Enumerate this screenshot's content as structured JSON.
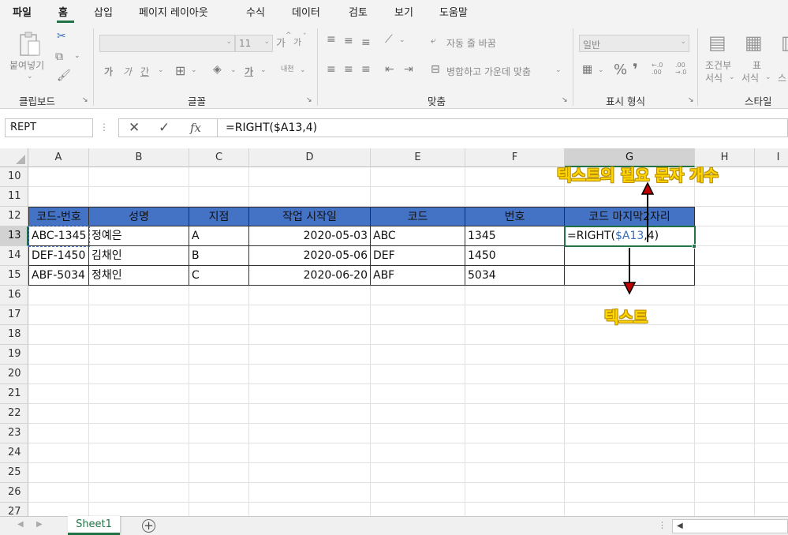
{
  "menu": {
    "tabs": [
      "파일",
      "홈",
      "삽입",
      "페이지 레이아웃",
      "수식",
      "데이터",
      "검토",
      "보기",
      "도움말"
    ]
  },
  "ribbon": {
    "clipboard": {
      "paste": "붙여넣기",
      "label": "클립보드"
    },
    "font": {
      "size": "11",
      "bold": "가",
      "italic": "가",
      "underline": "간",
      "grow": "가",
      "shrink": "가",
      "phonetic": "내천",
      "label": "글꼴"
    },
    "alignment": {
      "wrap": "자동 줄 바꿈",
      "merge": "병합하고 가운데 맞춤",
      "label": "맞춤"
    },
    "number": {
      "format": "일반",
      "percent": "%",
      "comma": "❜",
      "inc_decimal": "←.0\n.00",
      "dec_decimal": ".00\n→.0",
      "label": "표시 형식"
    },
    "styles": {
      "conditional_1": "조건부",
      "conditional_2": "서식",
      "table_1": "표",
      "table_2": "서식",
      "cell_2": "스",
      "label": "스타일"
    }
  },
  "formula_bar": {
    "name_box": "REPT",
    "cancel": "✕",
    "enter": "✓",
    "fx": "fx",
    "formula": "=RIGHT($A13,4)"
  },
  "grid": {
    "columns": [
      "A",
      "B",
      "C",
      "D",
      "E",
      "F",
      "G",
      "H",
      "I"
    ],
    "rows": [
      "10",
      "11",
      "12",
      "13",
      "14",
      "15",
      "16",
      "17",
      "18",
      "19",
      "20",
      "21",
      "22",
      "23",
      "24",
      "25",
      "26",
      "27"
    ],
    "headers": [
      "코드-번호",
      "성명",
      "지점",
      "작업 시작일",
      "코드",
      "번호",
      "코드 마지막2자리"
    ],
    "data": [
      [
        "ABC-1345",
        "정예은",
        "A",
        "2020-05-03",
        "ABC",
        "1345",
        ""
      ],
      [
        "DEF-1450",
        "김채인",
        "B",
        "2020-05-06",
        "DEF",
        "1450",
        ""
      ],
      [
        "ABF-5034",
        "정채인",
        "C",
        "2020-06-20",
        "ABF",
        "5034",
        ""
      ]
    ],
    "editing_formula": {
      "prefix": "=RIGHT(",
      "ref": "$A13",
      "suffix": ",4)"
    }
  },
  "annotations": {
    "top": "텍스트의 필요 문자 개수",
    "bottom": "텍스트"
  },
  "sheets": {
    "tabs": [
      "Sheet1"
    ],
    "add": "+"
  },
  "colors": {
    "accent": "#217346",
    "header_fill": "#4472c4",
    "annotation": "#ffd700",
    "arrow": "#c00000"
  }
}
